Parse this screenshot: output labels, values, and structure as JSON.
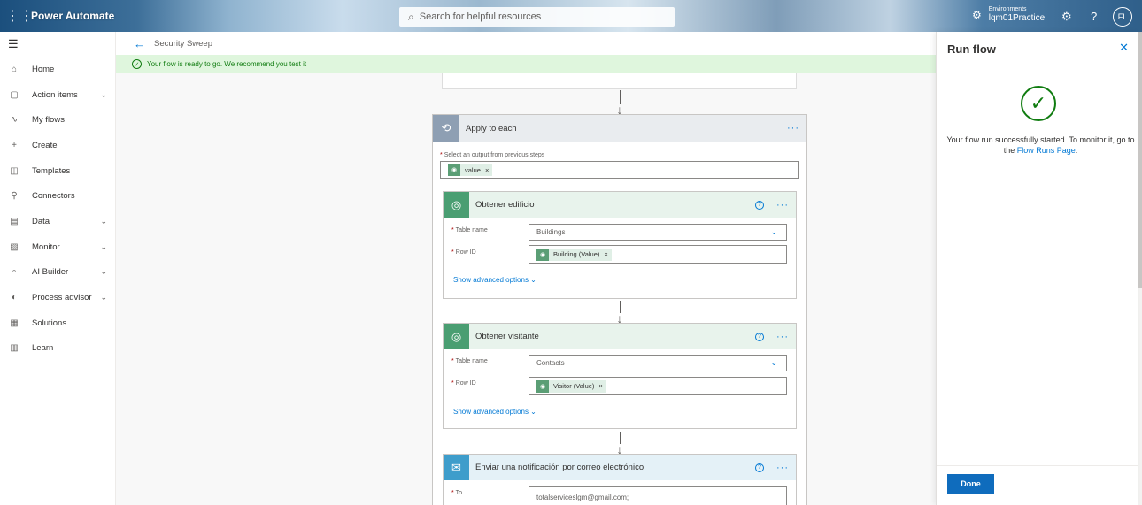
{
  "topbar": {
    "app_name": "Power Automate",
    "search_placeholder": "Search for helpful resources",
    "env_label": "Environments",
    "env_value": "lqm01Practice",
    "avatar_initials": "FL"
  },
  "sidebar": {
    "items": [
      {
        "label": "Home",
        "icon": "home-icon",
        "has_chevron": false
      },
      {
        "label": "Action items",
        "icon": "clipboard-icon",
        "has_chevron": true
      },
      {
        "label": "My flows",
        "icon": "flow-icon",
        "has_chevron": false
      },
      {
        "label": "Create",
        "icon": "plus-icon",
        "has_chevron": false
      },
      {
        "label": "Templates",
        "icon": "templates-icon",
        "has_chevron": false
      },
      {
        "label": "Connectors",
        "icon": "plug-icon",
        "has_chevron": false
      },
      {
        "label": "Data",
        "icon": "database-icon",
        "has_chevron": true
      },
      {
        "label": "Monitor",
        "icon": "monitor-icon",
        "has_chevron": true
      },
      {
        "label": "AI Builder",
        "icon": "ai-builder-icon",
        "has_chevron": true
      },
      {
        "label": "Process advisor",
        "icon": "process-advisor-icon",
        "has_chevron": true
      },
      {
        "label": "Solutions",
        "icon": "solutions-icon",
        "has_chevron": false
      },
      {
        "label": "Learn",
        "icon": "book-icon",
        "has_chevron": false
      }
    ]
  },
  "header": {
    "flow_name": "Security Sweep",
    "banner_text": "Your flow is ready to go. We recommend you test it"
  },
  "apply_to_each": {
    "title": "Apply to each",
    "select_label": "Select an output from previous steps",
    "token": "value",
    "steps": [
      {
        "title": "Obtener edificio",
        "table_label": "Table name",
        "table_value": "Buildings",
        "row_label": "Row ID",
        "row_token": "Building (Value)",
        "advanced": "Show advanced options"
      },
      {
        "title": "Obtener visitante",
        "table_label": "Table name",
        "table_value": "Contacts",
        "row_label": "Row ID",
        "row_token": "Visitor (Value)",
        "advanced": "Show advanced options"
      },
      {
        "title": "Enviar una notificación por correo electrónico",
        "to_label": "To",
        "to_value": "totalserviceslgm@gmail.com;"
      }
    ]
  },
  "run_panel": {
    "title": "Run flow",
    "message_before": "Your flow run successfully started. To monitor it, go to the ",
    "link_text": "Flow Runs Page",
    "message_after": ".",
    "done_label": "Done"
  },
  "colors": {
    "accent": "#0078d4",
    "success": "#107c10",
    "dataverse_green": "#4a9e72",
    "mail_blue": "#3e9dcb"
  }
}
